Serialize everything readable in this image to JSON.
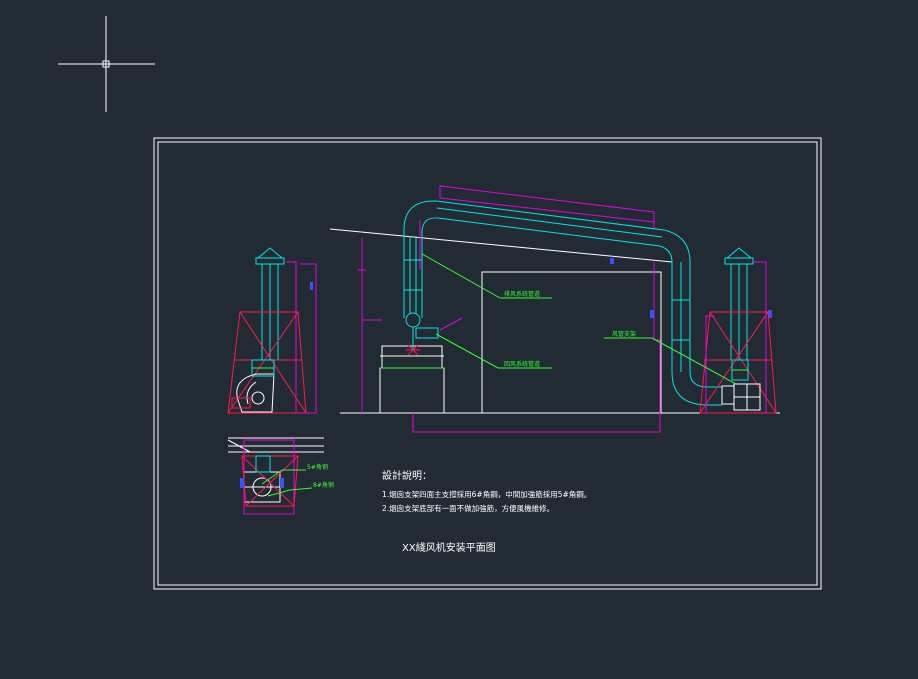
{
  "colors": {
    "background": "#222a33",
    "frame": "#ffffff",
    "duct": "#00e5e5",
    "support": "#e600e6",
    "structure": "#ff1a4a",
    "leader": "#33ff33",
    "machine": "#ffffff",
    "marker": "#3355ff"
  },
  "icons": {
    "crosshair": "crosshair-cursor-icon"
  },
  "labels": {
    "exhaust_duct": "排风系统管道",
    "return_duct": "回风系统管道",
    "duct_support": "风管支架",
    "angle_steel_a": "5#角钢",
    "angle_steel_b": "8#角钢"
  },
  "notes": {
    "heading": "設計說明：",
    "line1": "1.烟囱支架四面主支撐採用6#角鋼，中間加強筋採用5#角鋼。",
    "line2": "2.烟囱支架底部有一面不做加強筋，方便風機維修。"
  },
  "drawing_title": "XX綫风机安装平面图"
}
